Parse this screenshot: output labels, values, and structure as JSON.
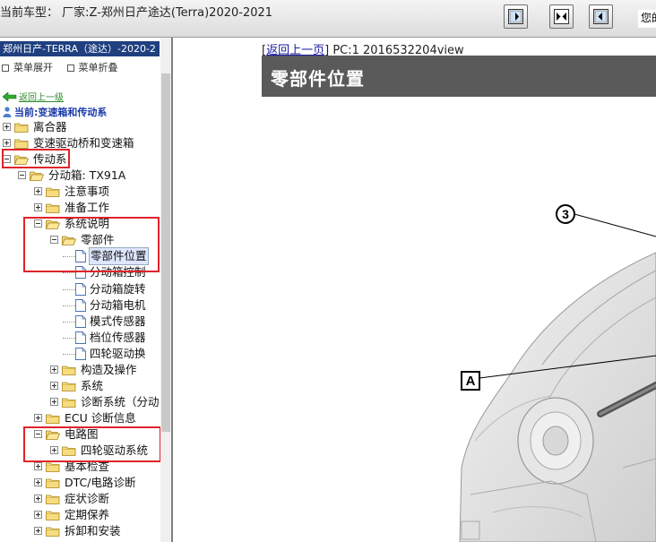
{
  "topbar": {
    "vehicle": "当前车型：  厂家:Z-郑州日产途达(Terra)2020-2021",
    "user_text": "您的"
  },
  "sidebar": {
    "header": "郑州日产-TERRA（途达）-2020-2",
    "menu_expand": "菜单展开",
    "menu_collapse": "菜单折叠",
    "back": "返回上一级",
    "current": "当前:变速箱和传动系",
    "tree": [
      {
        "label": "离合器"
      },
      {
        "label": "变速驱动桥和变速箱"
      },
      {
        "label": "传动系"
      },
      {
        "label": "分动箱: TX91A"
      },
      {
        "label": "注意事项"
      },
      {
        "label": "准备工作"
      },
      {
        "label": "系统说明"
      },
      {
        "label": "零部件"
      },
      {
        "label": "零部件位置"
      },
      {
        "label": "分动箱控制"
      },
      {
        "label": "分动箱旋转"
      },
      {
        "label": "分动箱电机"
      },
      {
        "label": "模式传感器"
      },
      {
        "label": "档位传感器"
      },
      {
        "label": "四轮驱动换"
      },
      {
        "label": "构造及操作"
      },
      {
        "label": "系统"
      },
      {
        "label": "诊断系统（分动"
      },
      {
        "label": "ECU 诊断信息"
      },
      {
        "label": "电路图"
      },
      {
        "label": "四轮驱动系统"
      },
      {
        "label": "基本检查"
      },
      {
        "label": "DTC/电路诊断"
      },
      {
        "label": "症状诊断"
      },
      {
        "label": "定期保养"
      },
      {
        "label": "拆卸和安装"
      }
    ]
  },
  "content": {
    "back_page": "返回上一页",
    "page_info": "PC:1 2016532204view",
    "title": "零部件位置",
    "callout_3": "3",
    "callout_a": "A"
  },
  "colors": {
    "highlight_box": "#e0232a",
    "title_bar": "#5a5a5a",
    "sidebar_header": "#1f3f7f"
  }
}
